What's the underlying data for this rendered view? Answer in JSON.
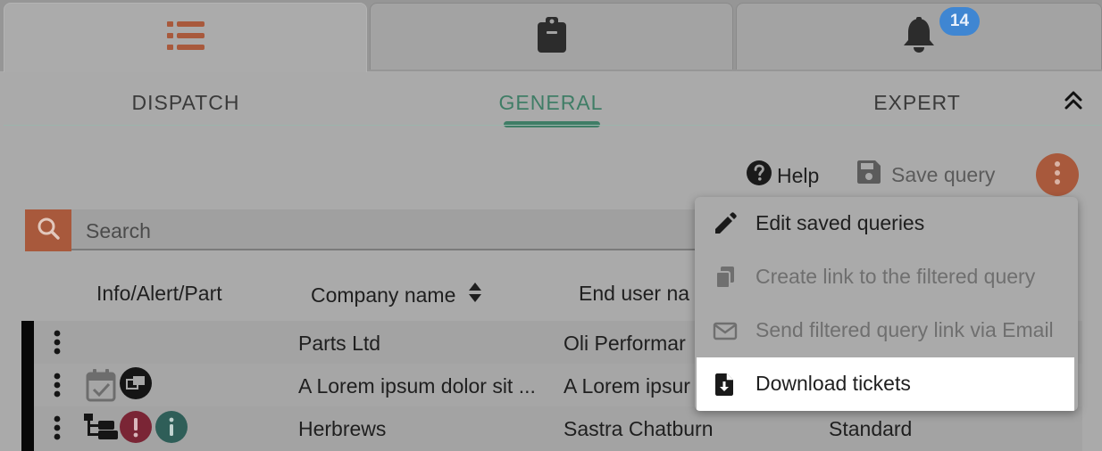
{
  "icon_tabs": [
    {
      "icon": "list-icon",
      "active": true
    },
    {
      "icon": "clipboard-icon",
      "active": false
    },
    {
      "icon": "bell-icon",
      "active": false,
      "badge": "14"
    }
  ],
  "tabs": [
    {
      "label": "DISPATCH",
      "active": false
    },
    {
      "label": "GENERAL",
      "active": true
    },
    {
      "label": "EXPERT",
      "active": false
    }
  ],
  "toolbar": {
    "help_label": "Help",
    "save_query_label": "Save query"
  },
  "search": {
    "placeholder": "Search",
    "value": ""
  },
  "table": {
    "columns": [
      {
        "label": "Info/Alert/Part"
      },
      {
        "label": "Company name",
        "sortable": true
      },
      {
        "label": "End user na"
      }
    ],
    "rows": [
      {
        "company": "Parts Ltd",
        "end_user": "Oli Performar",
        "extra": "",
        "icons": []
      },
      {
        "company": "A Lorem ipsum dolor sit ...",
        "end_user": "A Lorem ipsur",
        "extra": "",
        "icons": [
          "calendar-check-icon",
          "multi-window-icon"
        ]
      },
      {
        "company": "Herbrews",
        "end_user": "Sastra Chatburn",
        "extra": "Standard",
        "icons": [
          "hierarchy-icon",
          "alert-icon",
          "info-icon"
        ]
      }
    ]
  },
  "menu": {
    "items": [
      {
        "label": "Edit saved queries",
        "icon": "pencil-icon",
        "state": "enabled"
      },
      {
        "label": "Create link to the filtered query",
        "icon": "copy-icon",
        "state": "disabled"
      },
      {
        "label": "Send filtered query link via Email",
        "icon": "envelope-icon",
        "state": "disabled"
      },
      {
        "label": "Download tickets",
        "icon": "file-download-icon",
        "state": "highlighted"
      }
    ]
  },
  "colors": {
    "accent": "#a8593c",
    "tab_active": "#3f7d66",
    "badge": "#3f86d2",
    "alert": "#7a2535",
    "info": "#2f5e58"
  }
}
